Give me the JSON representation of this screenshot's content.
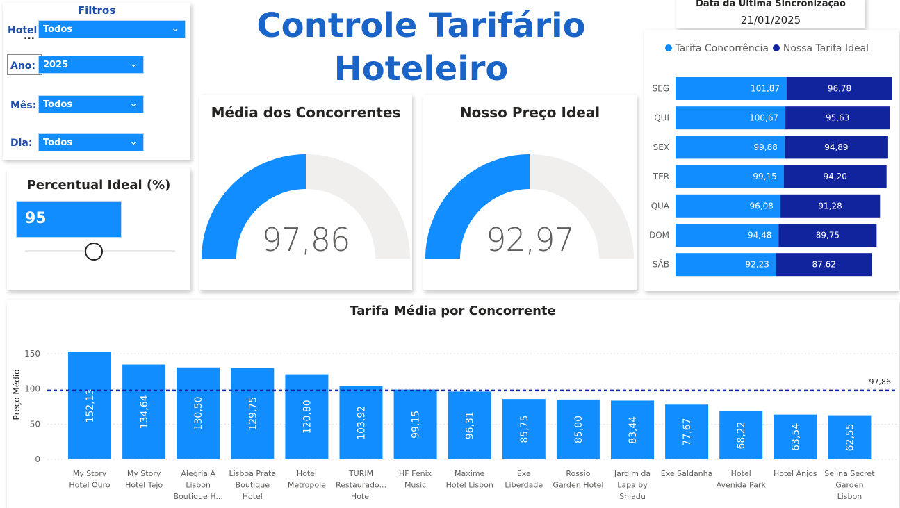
{
  "title": {
    "line1": "Controle Tarifário",
    "line2": "Hoteleiro"
  },
  "sync": {
    "label": "Data da Ultima Sincronização",
    "date": "21/01/2025"
  },
  "filters": {
    "heading": "Filtros",
    "more": "...",
    "hotel": {
      "label": "Hotel:",
      "value": "Todos"
    },
    "ano": {
      "label": "Ano:",
      "value": "2025"
    },
    "mes": {
      "label": "Mês:",
      "value": "Todos"
    },
    "dia": {
      "label": "Dia:",
      "value": "Todos"
    }
  },
  "percent_ideal": {
    "title": "Percentual Ideal (%)",
    "value": "95",
    "slider_fraction": 0.2
  },
  "gauges": [
    {
      "title": "Média dos Concorrentes",
      "value": "97,86",
      "fraction": 0.5
    },
    {
      "title": "Nosso Preço Ideal",
      "value": "92,97",
      "fraction": 0.5
    }
  ],
  "colors": {
    "primary": "#118DFF",
    "dark": "#12239E",
    "gauge_bg": "#F0EFEE",
    "title": "#1a63c7",
    "filter_label": "#1f4fa8"
  },
  "chart_data": [
    {
      "type": "bar",
      "orientation": "horizontal-stacked",
      "legend_position": "top",
      "categories": [
        "SEG",
        "QUI",
        "SEX",
        "TER",
        "QUA",
        "DOM",
        "SÁB"
      ],
      "series": [
        {
          "name": "Tarifa Concorrência",
          "color": "#118DFF",
          "values": [
            101.87,
            100.67,
            99.88,
            99.15,
            96.08,
            94.48,
            92.23
          ],
          "labels": [
            "101,87",
            "100,67",
            "99,88",
            "99,15",
            "96,08",
            "94,48",
            "92,23"
          ]
        },
        {
          "name": "Nossa Tarifa Ideal",
          "color": "#12239E",
          "values": [
            96.78,
            95.63,
            94.89,
            94.2,
            91.28,
            89.75,
            87.62
          ],
          "labels": [
            "96,78",
            "95,63",
            "94,89",
            "94,20",
            "91,28",
            "89,75",
            "87,62"
          ]
        }
      ]
    },
    {
      "type": "bar",
      "title": "Tarifa Média por Concorrente",
      "ylabel": "Preço Médio",
      "xlabel": "",
      "ylim": [
        0,
        160
      ],
      "yticks": [
        0,
        50,
        100,
        150
      ],
      "grid": true,
      "reference_line": {
        "value": 97.86,
        "label": "97,86"
      },
      "categories": [
        [
          "My Story",
          "Hotel Ouro"
        ],
        [
          "My Story",
          "Hotel Tejo"
        ],
        [
          "Alegria A",
          "Lisbon",
          "Boutique H..."
        ],
        [
          "Lisboa Prata",
          "Boutique",
          "Hotel"
        ],
        [
          "Hotel",
          "Metropole"
        ],
        [
          "TURIM",
          "Restaurado...",
          "Hotel"
        ],
        [
          "HF Fenix",
          "Music"
        ],
        [
          "Maxime",
          "Hotel Lisbon"
        ],
        [
          "Exe",
          "Liberdade"
        ],
        [
          "Rossio",
          "Garden Hotel"
        ],
        [
          "Jardim da",
          "Lapa by",
          "Shiadu"
        ],
        [
          "Exe Saldanha"
        ],
        [
          "Hotel",
          "Avenida Park"
        ],
        [
          "Hotel Anjos"
        ],
        [
          "Selina Secret",
          "Garden",
          "Lisbon"
        ]
      ],
      "values": [
        152.13,
        134.64,
        130.5,
        129.75,
        120.8,
        103.92,
        99.15,
        96.31,
        85.75,
        85.0,
        83.44,
        77.67,
        68.22,
        63.54,
        62.55
      ],
      "labels": [
        "152,13",
        "134,64",
        "130,50",
        "129,75",
        "120,80",
        "103,92",
        "99,15",
        "96,31",
        "85,75",
        "85,00",
        "83,44",
        "77,67",
        "68,22",
        "63,54",
        "62,55"
      ]
    }
  ]
}
